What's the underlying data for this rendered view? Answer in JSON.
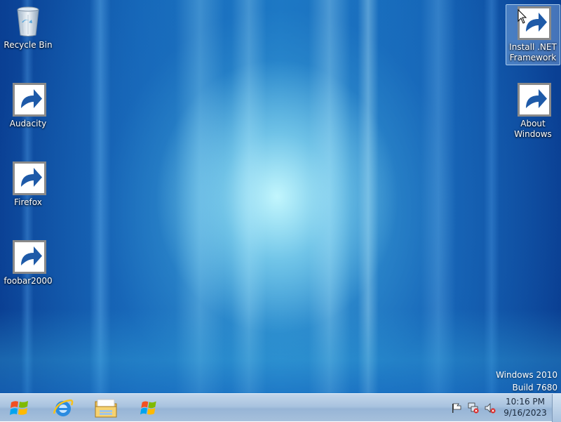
{
  "desktop": {
    "icons": [
      {
        "label": "Recycle Bin",
        "icon": "recycle-bin-icon"
      },
      {
        "label": "Audacity",
        "icon": "audacity-icon"
      },
      {
        "label": "Firefox",
        "icon": "firefox-icon"
      },
      {
        "label": "foobar2000",
        "icon": "foobar2000-icon"
      },
      {
        "label_line1": "Install .NET",
        "label_line2": "Framework",
        "icon": "dotnet-installer-shield-icon",
        "selected": true
      },
      {
        "label_line1": "About",
        "label_line2": "Windows",
        "icon": "windows-logo-icon"
      }
    ],
    "watermark": {
      "line1": "Windows 2010",
      "line2": "Build 7680"
    }
  },
  "taskbar": {
    "start": {
      "icon": "windows-start-orb-icon"
    },
    "pinned": [
      {
        "icon": "internet-explorer-icon"
      },
      {
        "icon": "file-explorer-folder-icon"
      },
      {
        "icon": "windows-logo-icon"
      }
    ],
    "tray": {
      "icons": [
        "action-center-flag-icon",
        "network-disconnected-icon",
        "volume-muted-icon"
      ],
      "time": "10:16 PM",
      "date": "9/16/2023"
    }
  },
  "colors": {
    "desktop_blue": "#1466b8",
    "desktop_glow": "#c8faff",
    "taskbar": "#a9c3df",
    "clock_text": "#1b2a3d"
  }
}
